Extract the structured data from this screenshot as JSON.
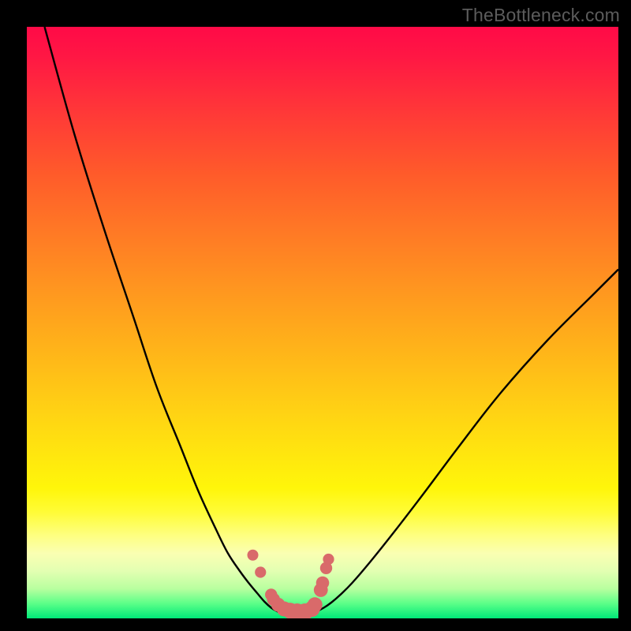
{
  "watermark": "TheBottleneck.com",
  "chart_data": {
    "type": "line",
    "title": "",
    "xlabel": "",
    "ylabel": "",
    "xlim": [
      0,
      100
    ],
    "ylim": [
      0,
      100
    ],
    "series": [
      {
        "name": "left-curve",
        "x": [
          3,
          8,
          13,
          18,
          22,
          26,
          29,
          32,
          34,
          36,
          37.5,
          39,
          40.2,
          41.3,
          42.3,
          43
        ],
        "values": [
          100,
          82,
          66,
          51,
          39,
          29,
          21.5,
          15,
          11,
          8,
          6,
          4.2,
          2.8,
          1.8,
          1.2,
          0.9
        ]
      },
      {
        "name": "right-curve",
        "x": [
          48,
          49,
          50.2,
          51.5,
          53,
          55,
          58,
          62,
          67,
          73,
          80,
          88,
          96,
          100
        ],
        "values": [
          0.9,
          1.2,
          1.8,
          2.7,
          4,
          6,
          9.5,
          14.5,
          21,
          29,
          38,
          47,
          55,
          59
        ]
      }
    ],
    "annotations": {
      "floor_markers": {
        "name": "valley-floor-markers",
        "points": [
          {
            "x": 38.2,
            "y": 10.7
          },
          {
            "x": 39.5,
            "y": 7.8
          },
          {
            "x": 41.3,
            "y": 4.0
          },
          {
            "x": 41.7,
            "y": 3.2
          },
          {
            "x": 42.5,
            "y": 2.3
          },
          {
            "x": 43.5,
            "y": 1.6
          },
          {
            "x": 44.5,
            "y": 1.3
          },
          {
            "x": 45.7,
            "y": 1.1
          },
          {
            "x": 47.0,
            "y": 1.1
          },
          {
            "x": 48.2,
            "y": 1.6
          },
          {
            "x": 48.7,
            "y": 2.3
          },
          {
            "x": 49.7,
            "y": 4.8
          },
          {
            "x": 50.0,
            "y": 6.0
          },
          {
            "x": 50.6,
            "y": 8.5
          },
          {
            "x": 51.0,
            "y": 10.0
          }
        ]
      }
    },
    "colors": {
      "curve": "#000000",
      "marker": "#d96a6a",
      "background_top": "#ff0a47",
      "background_bottom": "#00e878"
    }
  }
}
